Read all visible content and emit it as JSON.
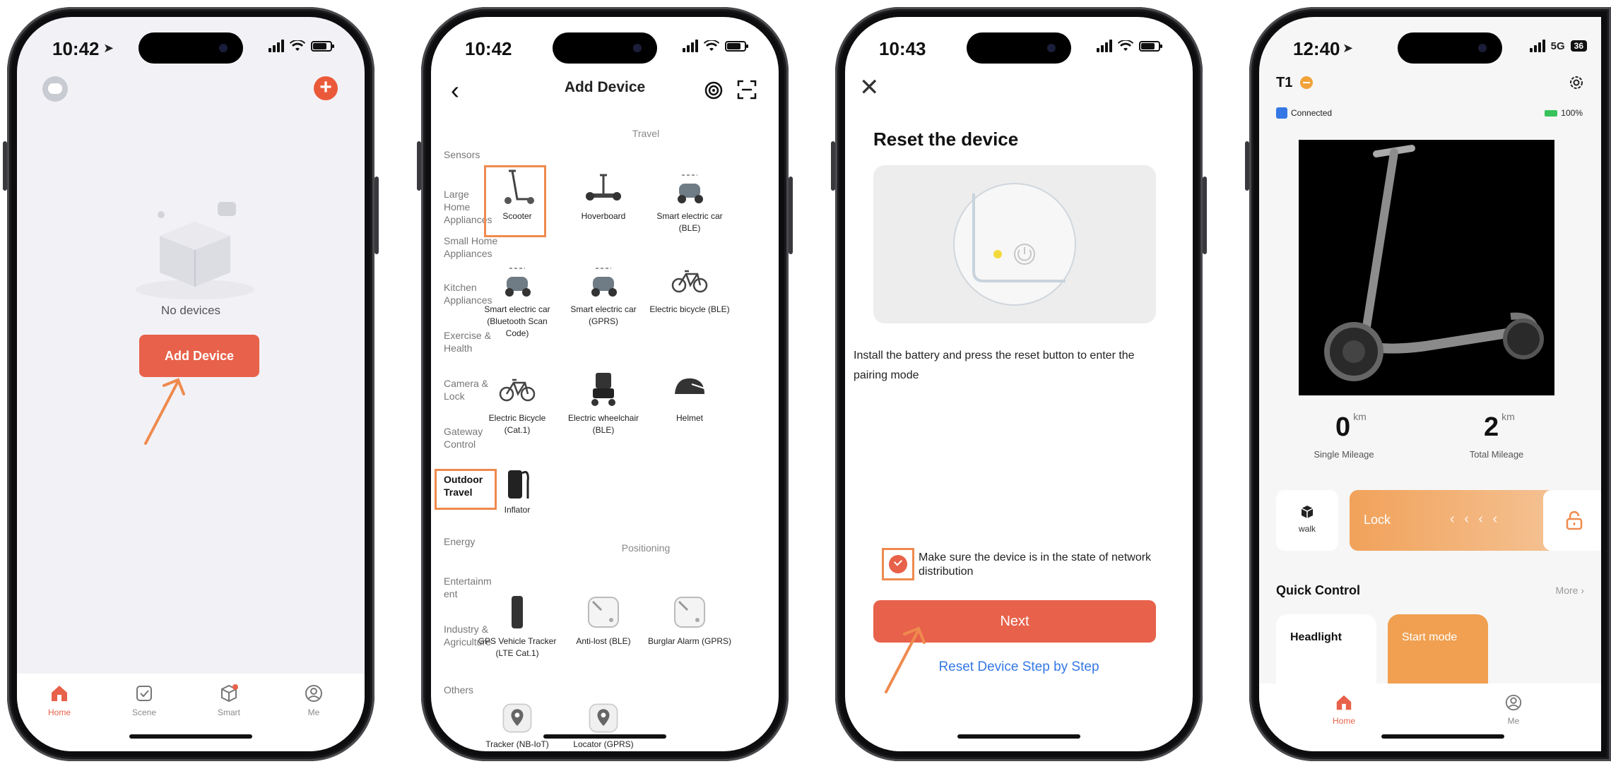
{
  "phone1": {
    "time": "10:42",
    "empty_text": "No devices",
    "add_button": "Add Device",
    "tabs": [
      "Home",
      "Scene",
      "Smart",
      "Me"
    ]
  },
  "phone2": {
    "time": "10:42",
    "title": "Add Device",
    "categories": [
      "Sensors",
      "Large Home Appliances",
      "Small Home Appliances",
      "Kitchen Appliances",
      "Exercise & Health",
      "Camera & Lock",
      "Gateway Control",
      "Outdoor Travel",
      "Energy",
      "Entertainm ent",
      "Industry & Agriculture",
      "Others"
    ],
    "active_category": "Outdoor Travel",
    "sections": {
      "travel": "Travel",
      "positioning": "Positioning"
    },
    "devices": [
      "Scooter",
      "Hoverboard",
      "Smart electric car (BLE)",
      "Smart electric car (Bluetooth Scan Code)",
      "Smart electric car (GPRS)",
      "Electric bicycle (BLE)",
      "Electric Bicycle (Cat.1)",
      "Electric wheelchair (BLE)",
      "Helmet",
      "Inflator",
      "GPS Vehicle Tracker (LTE Cat.1)",
      "Anti-lost (BLE)",
      "Burglar Alarm (GPRS)",
      "Tracker (NB-IoT)",
      "Locator (GPRS)"
    ]
  },
  "phone3": {
    "time": "10:43",
    "title": "Reset the device",
    "description": "Install the battery and press the reset button to enter the pairing mode",
    "checkbox_label": "Make sure the device is in the state of network distribution",
    "next_button": "Next",
    "link": "Reset Device Step by Step"
  },
  "phone4": {
    "time": "12:40",
    "network": "5G",
    "battery_badge": "36",
    "device_name": "T1",
    "connection": "Connected",
    "battery_level": "100%",
    "single_mileage": {
      "value": "0",
      "unit": "km",
      "label": "Single Mileage"
    },
    "total_mileage": {
      "value": "2",
      "unit": "km",
      "label": "Total Mileage"
    },
    "walk_label": "walk",
    "lock_label": "Lock",
    "lock_chevrons": "‹ ‹ ‹ ‹",
    "quick_control": "Quick Control",
    "more": "More ›",
    "cards": [
      "Headlight",
      "Start mode"
    ],
    "tabs": [
      "Home",
      "Me"
    ]
  },
  "colors": {
    "accent": "#e8614a",
    "highlight": "#ef8a4e",
    "link": "#3578e5",
    "lock_gradient_start": "#f1a25a"
  }
}
